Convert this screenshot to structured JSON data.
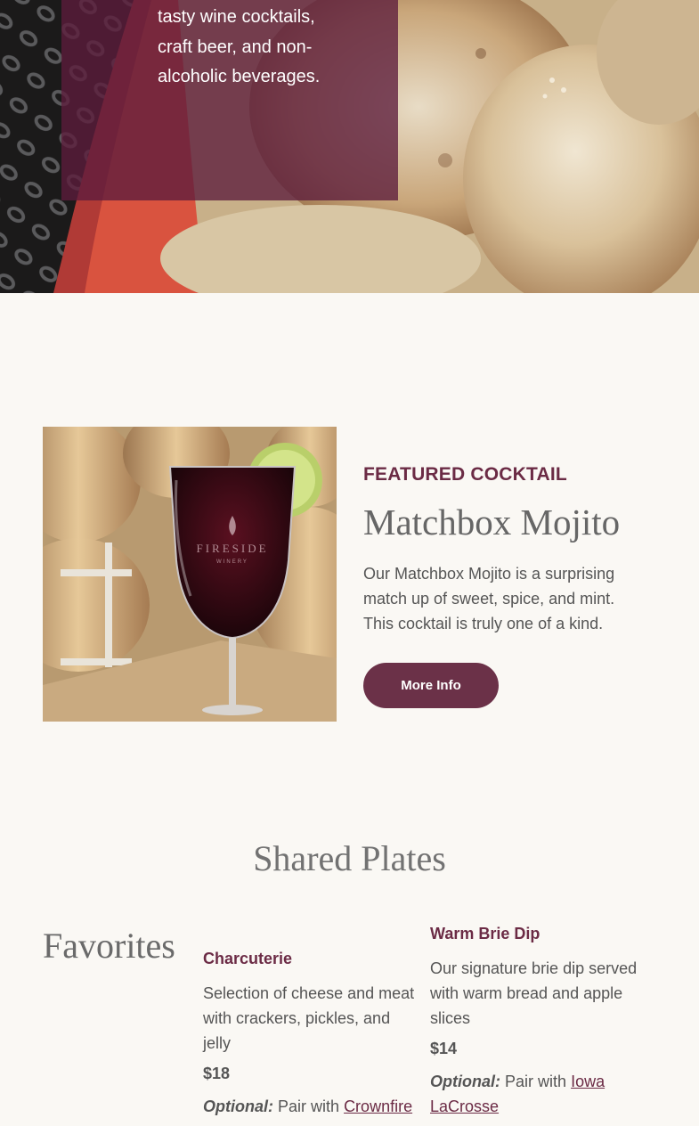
{
  "hero": {
    "text": "tasty wine cocktails, craft beer, and non-alcoholic beverages."
  },
  "featured": {
    "eyebrow": "FEATURED COCKTAIL",
    "title": "Matchbox Mojito",
    "description": "Our Matchbox Mojito is a surprising match up of sweet, spice, and mint. This cocktail is truly one of a kind.",
    "button_label": "More Info",
    "glass_brand": "FIRESIDE",
    "glass_sub": "WINERY"
  },
  "shared_plates": {
    "title": "Shared Plates",
    "category": "Favorites",
    "items": [
      {
        "name": "Charcuterie",
        "description": "Selection of cheese and meat with crackers, pickles, and jelly",
        "price": "$18",
        "optional_label": "Optional:",
        "pair_text": "Pair with",
        "pair_link": "Crownfire"
      },
      {
        "name": "Warm Brie Dip",
        "description": "Our signature brie dip served with warm bread and apple slices",
        "price": "$14",
        "optional_label": "Optional:",
        "pair_text": "Pair with",
        "pair_link": "Iowa LaCrosse"
      }
    ]
  },
  "colors": {
    "accent": "#6b2b45",
    "button": "#6b3148",
    "background": "#faf8f4"
  }
}
